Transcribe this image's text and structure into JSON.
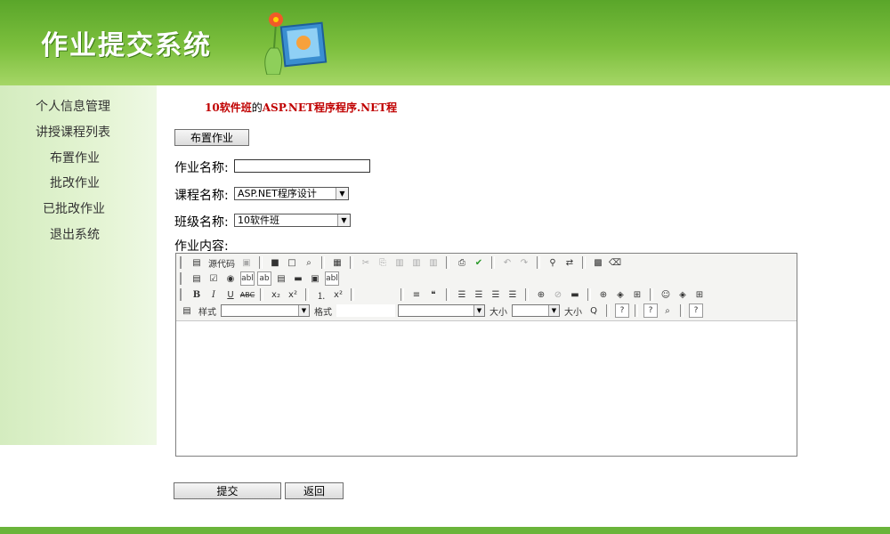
{
  "header": {
    "title": "作业提交系统"
  },
  "sidebar": {
    "items": [
      {
        "label": "个人信息管理"
      },
      {
        "label": "讲授课程列表"
      },
      {
        "label": "布置作业"
      },
      {
        "label": "批改作业"
      },
      {
        "label": "已批改作业"
      },
      {
        "label": "退出系统"
      }
    ]
  },
  "course": {
    "class_name": "10软件班",
    "connector": "的",
    "course_name": "ASP.NET程序程序.NET程"
  },
  "main": {
    "assign_button": "布置作业",
    "homework_name_label": "作业名称:",
    "homework_name_value": "",
    "course_name_label": "课程名称:",
    "course_select_value": "ASP.NET程序设计",
    "class_name_label": "班级名称:",
    "class_select_value": "10软件班",
    "content_label": "作业内容:"
  },
  "editor": {
    "source_label": "源代码",
    "style_label": "样式",
    "format_label": "格式",
    "size_label": "大小",
    "size_label2": "大小"
  },
  "actions": {
    "submit": "提交",
    "back": "返回"
  },
  "colors": {
    "header_green": "#6ab43a",
    "sidebar_bg": "#e6f5d6",
    "course_red": "#c00000"
  }
}
